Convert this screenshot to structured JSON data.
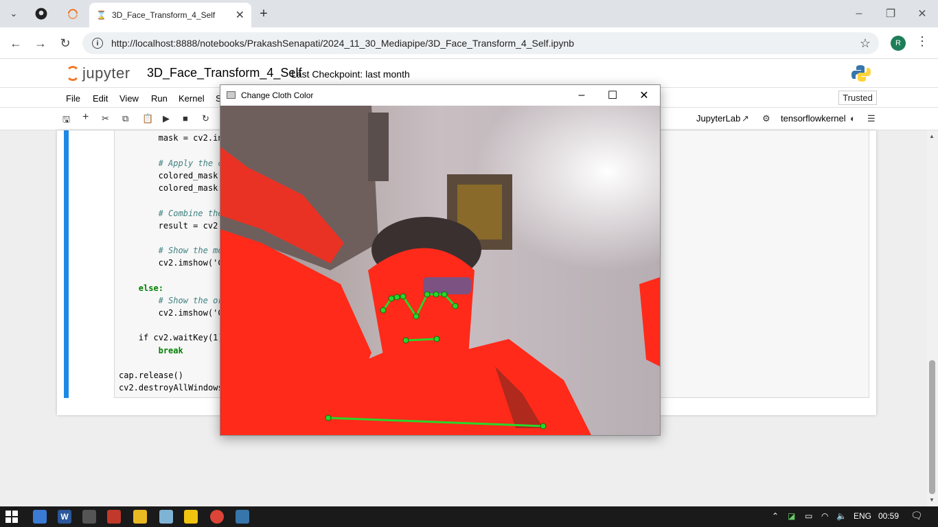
{
  "browser": {
    "tab_title": "3D_Face_Transform_4_Self",
    "url": "http://localhost:8888/notebooks/PrakashSenapati/2024_11_30_Mediapipe/3D_Face_Transform_4_Self.ipynb",
    "profile_initial": "R"
  },
  "jupyter": {
    "logo_text": "jupyter",
    "notebook_title": "3D_Face_Transform_4_Self",
    "checkpoint": "Last Checkpoint: last month",
    "menus": [
      "File",
      "Edit",
      "View",
      "Run",
      "Kernel",
      "S"
    ],
    "trusted": "Trusted",
    "jupyterlab_link": "JupyterLab",
    "kernel_name": "tensorflowkernel"
  },
  "code_lines": [
    {
      "indent": 8,
      "text": "mask = cv2.in",
      "kind": "code"
    },
    {
      "indent": 8,
      "text": "# Apply the c",
      "kind": "comment"
    },
    {
      "indent": 8,
      "text": "colored_mask",
      "kind": "code"
    },
    {
      "indent": 8,
      "text": "colored_mask[",
      "kind": "code"
    },
    {
      "indent": 8,
      "text": "# Combine the",
      "kind": "comment"
    },
    {
      "indent": 8,
      "text": "result = cv2.",
      "kind": "code"
    },
    {
      "indent": 8,
      "text": "# Show the mo",
      "kind": "comment"
    },
    {
      "indent": 8,
      "text": "cv2.imshow('C",
      "kind": "code"
    },
    {
      "indent": 4,
      "text": "else:",
      "kind": "keyword"
    },
    {
      "indent": 8,
      "text": "# Show the or",
      "kind": "comment"
    },
    {
      "indent": 8,
      "text": "cv2.imshow('C",
      "kind": "code"
    },
    {
      "indent": 4,
      "text": "if cv2.waitKey(1)",
      "kind": "code"
    },
    {
      "indent": 8,
      "text": "break",
      "kind": "keyword"
    },
    {
      "indent": 0,
      "text": "cap.release()",
      "kind": "code"
    },
    {
      "indent": 0,
      "text": "cv2.destroyAllWindows",
      "kind": "code"
    }
  ],
  "cv_window": {
    "title": "Change Cloth Color"
  },
  "taskbar": {
    "language": "ENG",
    "time": "00:59"
  },
  "colors": {
    "cell_accent": "#1e88e5",
    "mask_red": "#ff2a1a",
    "landmark_green": "#2ad62a"
  }
}
